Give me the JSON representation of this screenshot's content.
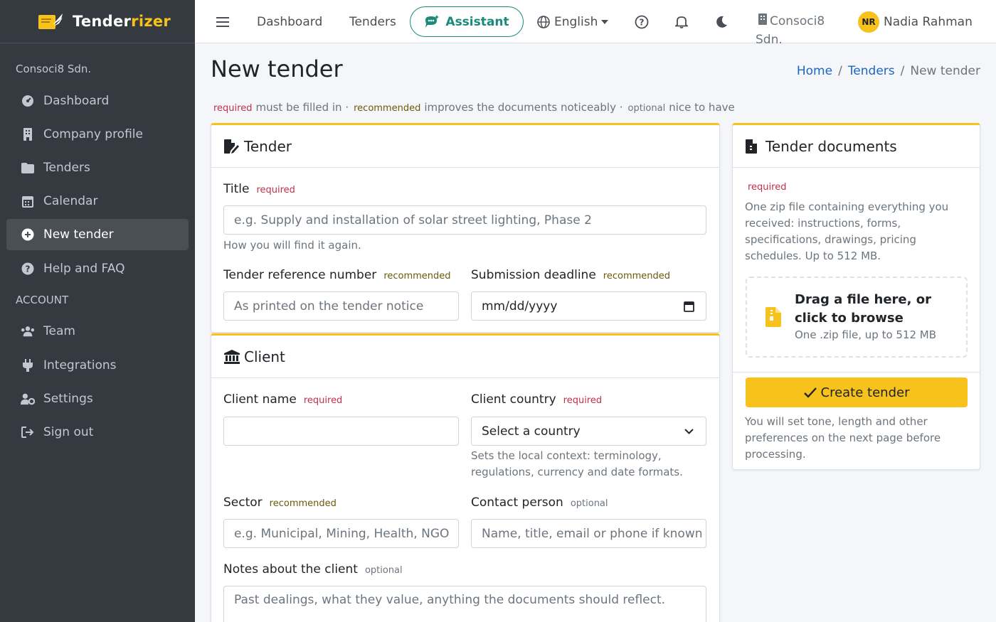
{
  "brand": {
    "name_main": "Tender",
    "name_accent": "rizer"
  },
  "sidebar": {
    "org": "Consoci8 Sdn.",
    "items": [
      {
        "label": "Dashboard",
        "icon": "gauge-icon"
      },
      {
        "label": "Company profile",
        "icon": "building-icon"
      },
      {
        "label": "Tenders",
        "icon": "folder-icon"
      },
      {
        "label": "Calendar",
        "icon": "calendar-icon"
      },
      {
        "label": "New tender",
        "icon": "plus-circle-icon",
        "active": true
      },
      {
        "label": "Help and FAQ",
        "icon": "question-circle-icon"
      }
    ],
    "account_label": "ACCOUNT",
    "account_items": [
      {
        "label": "Team",
        "icon": "users-icon"
      },
      {
        "label": "Integrations",
        "icon": "plug-icon"
      },
      {
        "label": "Settings",
        "icon": "user-gear-icon"
      },
      {
        "label": "Sign out",
        "icon": "sign-out-icon"
      }
    ]
  },
  "topbar": {
    "menu_icon": "hamburger-icon",
    "dashboard": "Dashboard",
    "tenders": "Tenders",
    "assistant": "Assistant",
    "language": "English",
    "org_line1": "Consoci8",
    "org_line2": "Sdn.",
    "user_initials": "NR",
    "user_name": "Nadia Rahman"
  },
  "page": {
    "title": "New tender",
    "breadcrumb": [
      "Home",
      "Tenders",
      "New tender"
    ],
    "legend": {
      "required_tag": "required",
      "required_text": "must be filled in ·",
      "recommended_tag": "recommended",
      "recommended_text": "improves the documents noticeably ·",
      "optional_tag": "optional",
      "optional_text": "nice to have"
    }
  },
  "tender_card": {
    "title": "Tender",
    "title_label": "Title",
    "title_tag": "required",
    "title_placeholder": "e.g. Supply and installation of solar street lighting, Phase 2",
    "title_help": "How you will find it again.",
    "ref_label": "Tender reference number",
    "ref_tag": "recommended",
    "ref_placeholder": "As printed on the tender notice",
    "deadline_label": "Submission deadline",
    "deadline_tag": "recommended",
    "deadline_placeholder": "mm/dd/yyyy"
  },
  "client_card": {
    "title": "Client",
    "name_label": "Client name",
    "name_tag": "required",
    "name_value": "",
    "country_label": "Client country",
    "country_tag": "required",
    "country_value": "Select a country",
    "country_help": "Sets the local context: terminology, regulations, currency and date formats.",
    "sector_label": "Sector",
    "sector_tag": "recommended",
    "sector_placeholder": "e.g. Municipal, Mining, Health, NGO",
    "contact_label": "Contact person",
    "contact_tag": "optional",
    "contact_placeholder": "Name, title, email or phone if known",
    "notes_label": "Notes about the client",
    "notes_tag": "optional",
    "notes_placeholder": "Past dealings, what they value, anything the documents should reflect."
  },
  "docs_card": {
    "title": "Tender documents",
    "tag": "required",
    "description": "One zip file containing everything you received: instructions, forms, specifications, drawings, pricing schedules. Up to 512 MB.",
    "drop_title": "Drag a file here, or click to browse",
    "drop_sub": "One .zip file, up to 512 MB",
    "create_button": "Create tender",
    "after_note": "You will set tone, length and other preferences on the next page before processing."
  },
  "colors": {
    "sidebar_bg": "#343a40",
    "accent": "#f8c21c",
    "assistant": "#1b8a7a",
    "link": "#1a66c2",
    "required": "#c0304a"
  }
}
